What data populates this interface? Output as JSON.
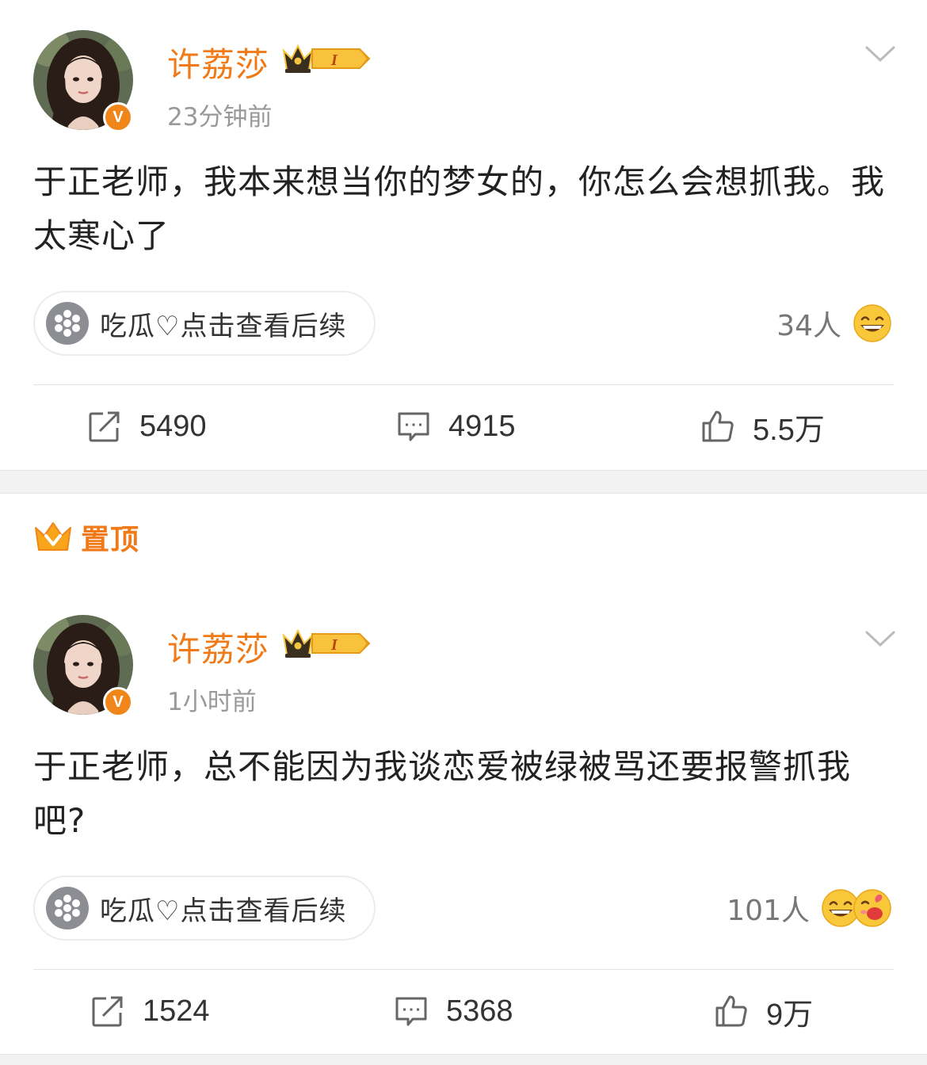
{
  "colors": {
    "accent": "#f07a18",
    "muted": "#999999",
    "text": "#222222",
    "badge": "#f08619"
  },
  "pinned": {
    "label": "置顶",
    "icon": "pinned-crown-icon"
  },
  "posts": [
    {
      "username": "许荔莎",
      "vip_level": "I",
      "verified_mark": "V",
      "time": "23分钟前",
      "content": "于正老师，我本来想当你的梦女的，你怎么会想抓我。我太寒心了",
      "topic_pill": "吃瓜♡点击查看后续",
      "reaction_count": "34人",
      "reaction_icons": [
        "grin-emoji-icon"
      ],
      "repost_count": "5490",
      "comment_count": "4915",
      "like_count": "5.5万"
    },
    {
      "username": "许荔莎",
      "vip_level": "I",
      "verified_mark": "V",
      "time": "1小时前",
      "content": "于正老师，总不能因为我谈恋爱被绿被骂还要报警抓我吧?",
      "topic_pill": "吃瓜♡点击查看后续",
      "reaction_count": "101人",
      "reaction_icons": [
        "grin-emoji-icon",
        "love-emoji-icon"
      ],
      "repost_count": "1524",
      "comment_count": "5368",
      "like_count": "9万"
    }
  ]
}
